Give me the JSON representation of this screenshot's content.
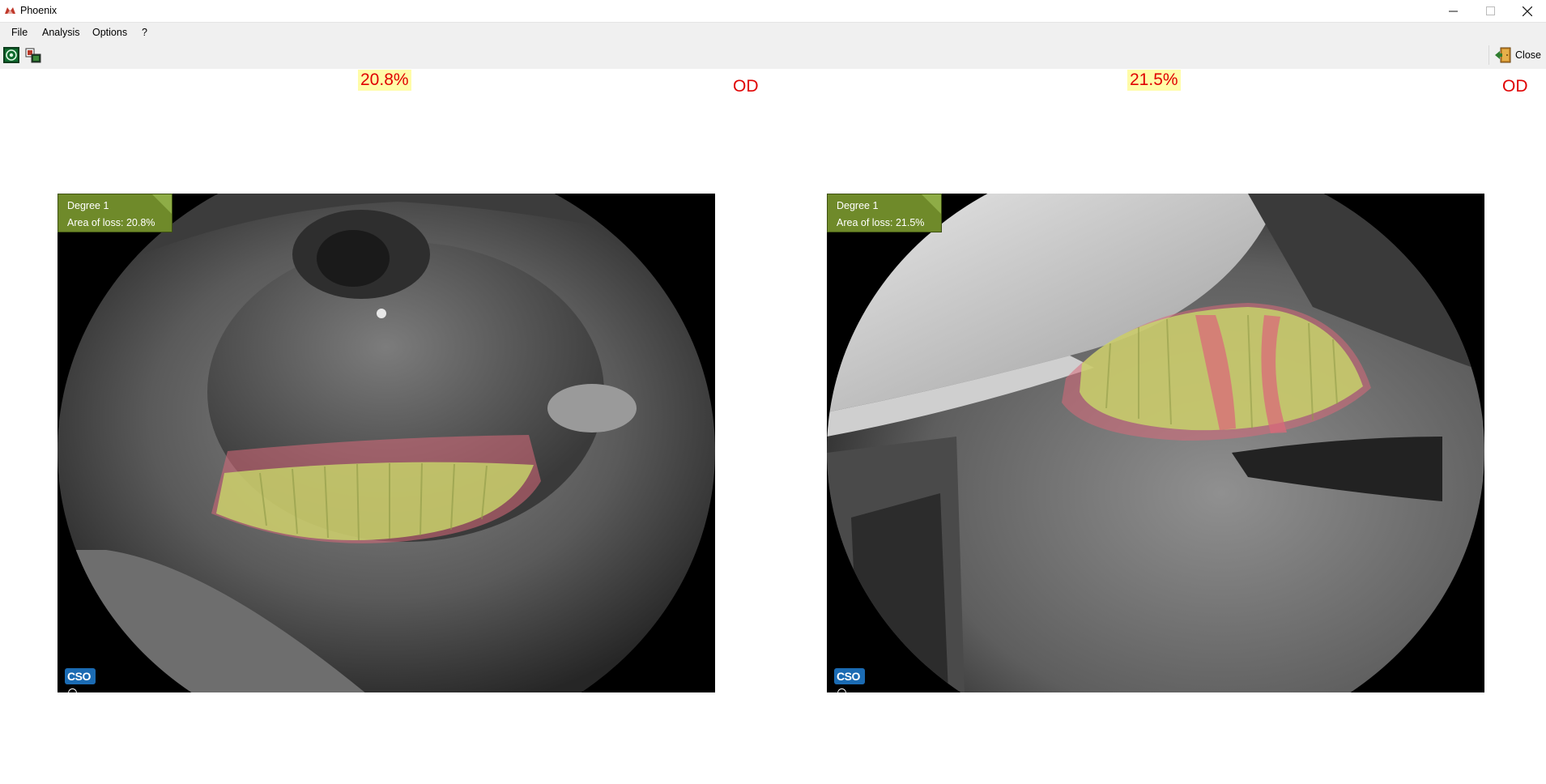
{
  "window": {
    "title": "Phoenix",
    "minimize_icon": "minimize-icon",
    "maximize_icon": "maximize-icon",
    "close_icon": "close-icon"
  },
  "menu": {
    "items": [
      "File",
      "Analysis",
      "Options",
      "?"
    ]
  },
  "toolbar": {
    "icons": [
      "eye-capture-icon",
      "image-compare-icon"
    ],
    "close_label": "Close",
    "close_icon": "exit-door-icon"
  },
  "panels": [
    {
      "percent": "20.8%",
      "eye": "OD",
      "degree": "Degree 1",
      "area_of_loss": "Area of loss: 20.8%",
      "logo": "CSO"
    },
    {
      "percent": "21.5%",
      "eye": "OD",
      "degree": "Degree 1",
      "area_of_loss": "Area of loss: 21.5%",
      "logo": "CSO"
    }
  ],
  "colors": {
    "percent_text": "#e00000",
    "percent_bg": "#fffca8",
    "overlay_green": "#c8d86a",
    "overlay_red": "#d96a7a",
    "degree_box": "#6f8a2a",
    "logo_blue": "#1b6bb3"
  }
}
